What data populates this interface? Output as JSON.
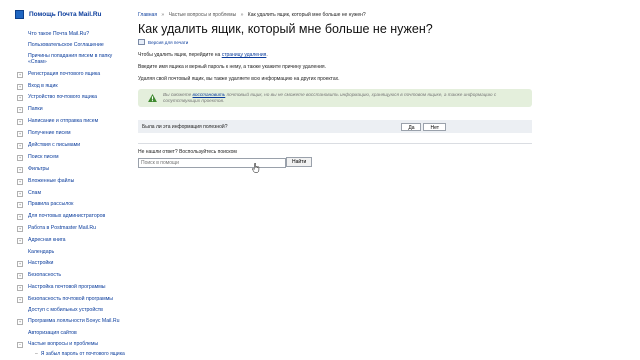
{
  "sidebar": {
    "title": "Помощь Почта Mail.Ru",
    "items": [
      {
        "label": "Что такое Почта Mail.Ru?",
        "toggle": false
      },
      {
        "label": "Пользовательское Соглашение",
        "toggle": false
      },
      {
        "label": "Причины попадания писем в папку «Спам»",
        "toggle": false
      },
      {
        "label": "Регистрация почтового ящика",
        "toggle": true
      },
      {
        "label": "Вход в ящик",
        "toggle": true
      },
      {
        "label": "Устройство почтового ящика",
        "toggle": true
      },
      {
        "label": "Папки",
        "toggle": true
      },
      {
        "label": "Написание и отправка писем",
        "toggle": true
      },
      {
        "label": "Получение писем",
        "toggle": true
      },
      {
        "label": "Действия с письмами",
        "toggle": true
      },
      {
        "label": "Поиск писем",
        "toggle": true
      },
      {
        "label": "Фильтры",
        "toggle": true
      },
      {
        "label": "Вложенные файлы",
        "toggle": true
      },
      {
        "label": "Спам",
        "toggle": true
      },
      {
        "label": "Правила рассылок",
        "toggle": true
      },
      {
        "label": "Для почтовых администраторов",
        "toggle": true
      },
      {
        "label": "Работа в Postmaster Mail.Ru",
        "toggle": true
      },
      {
        "label": "Адресная книга",
        "toggle": true
      },
      {
        "label": "Календарь",
        "toggle": false
      },
      {
        "label": "Настройки",
        "toggle": true
      },
      {
        "label": "Безопасность",
        "toggle": true
      },
      {
        "label": "Настройка почтовой программы",
        "toggle": true
      },
      {
        "label": "Безопасность почтовой программы",
        "toggle": true
      },
      {
        "label": "Доступ с мобильных устройств",
        "toggle": false
      },
      {
        "label": "Программа лояльности Бонус Mail.Ru",
        "toggle": true
      },
      {
        "label": "Авторизация сайтов",
        "toggle": false
      },
      {
        "label": "Частые вопросы и проблемы",
        "toggle": true,
        "toggle_symbol": "−"
      }
    ],
    "subitem": "Я забыл пароль от почтового ящика",
    "toggle_symbol": "+"
  },
  "breadcrumbs": [
    "Главная",
    "Частые вопросы и проблемы",
    "Как удалить ящик, который мне больше не нужен?"
  ],
  "breadcrumb_sep": "»",
  "title": "Как удалить ящик, который мне больше не нужен?",
  "print_link": "Версия для печати",
  "para1_prefix": "Чтобы удалить ящик, перейдите на ",
  "para1_link": "страницу удаления",
  "para1_suffix": ".",
  "para2": "Введите имя ящика и верный пароль к нему, а также укажите причину удаления.",
  "para3": "Удаляя свой почтовый ящик, вы также удаляете всю информацию на других проектах.",
  "warning": {
    "prefix": "Вы сможете ",
    "link": "восстановить",
    "suffix": " почтовый ящик, но вы не сможете восстановить информацию, хранящуюся в почтовом ящике, а также информацию с сопутствующих проектов."
  },
  "feedback": {
    "question": "Была ли эта информация полезной?",
    "yes": "Да",
    "no": "Нет"
  },
  "search": {
    "label": "Не нашли ответ? Воспользуйтесь поиском",
    "placeholder": "Поиск в помощи",
    "button": "Найти"
  },
  "colors": {
    "link": "#0a3c9c",
    "warning_bg": "#e4efdc",
    "feedback_bg": "#eceff3",
    "warning_icon": "#3f8a2f"
  }
}
